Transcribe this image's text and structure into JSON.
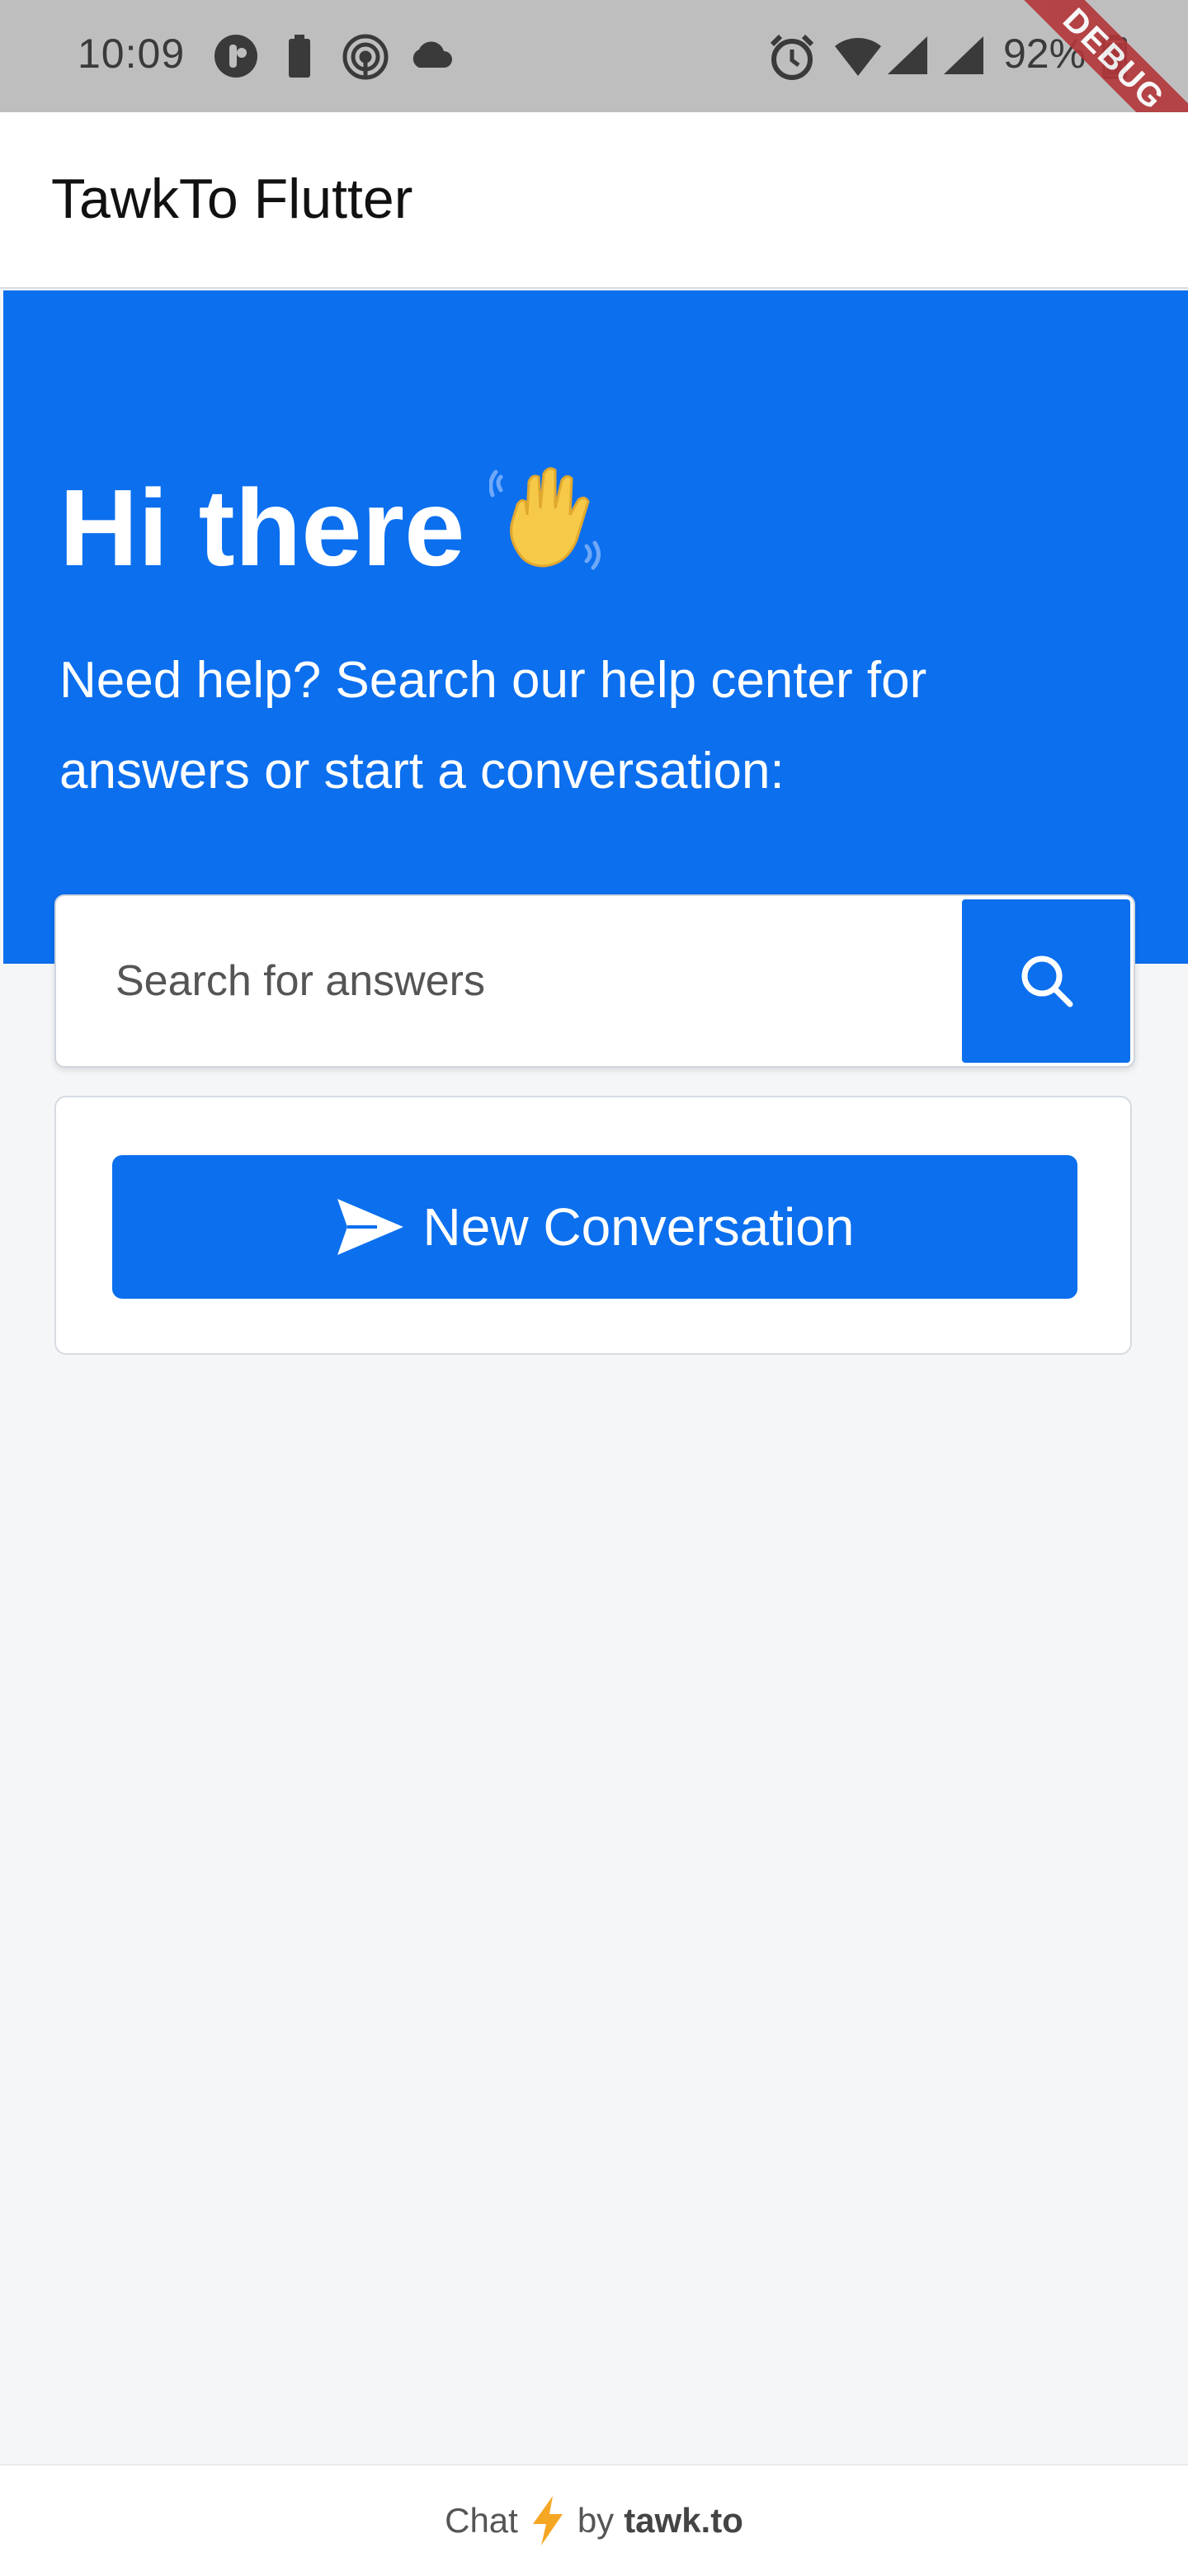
{
  "status_bar": {
    "time": "10:09",
    "battery": "92%",
    "debug_label": "DEBUG"
  },
  "app_bar": {
    "title": "TawkTo Flutter"
  },
  "hero": {
    "greeting": "Hi there",
    "greeting_emoji": "waving-hand",
    "subtitle": "Need help? Search our help center for answers or start a conversation:",
    "background_color": "#0b6fee"
  },
  "search": {
    "placeholder": "Search for answers",
    "value": ""
  },
  "conversation": {
    "button_label": "New Conversation"
  },
  "footer": {
    "prefix": "Chat",
    "middle": "by",
    "brand": "tawk.to"
  },
  "colors": {
    "accent": "#0b6fee",
    "page_background": "#f5f6f8",
    "bolt": "#f5a623"
  }
}
